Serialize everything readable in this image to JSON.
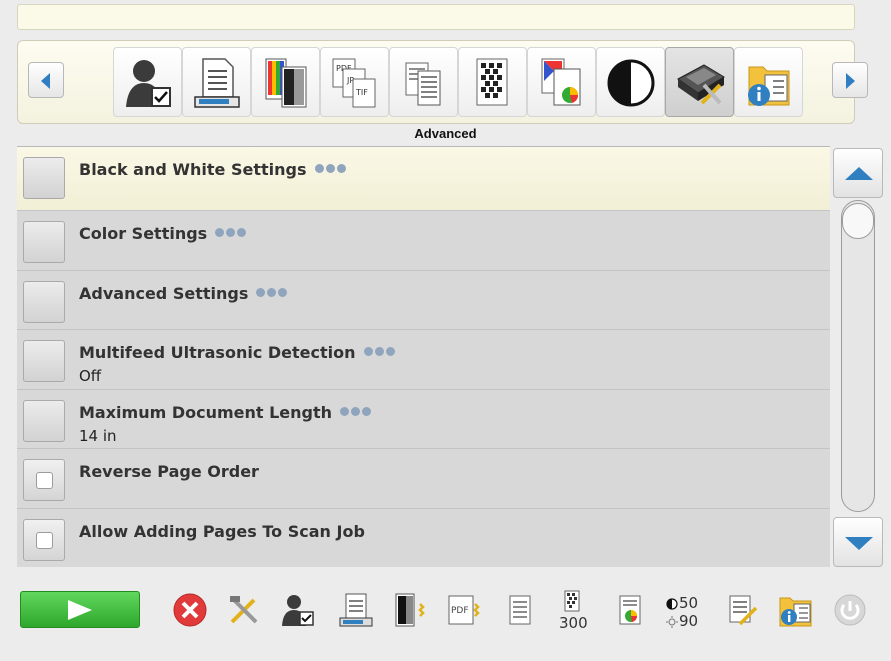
{
  "toolbar": {
    "icons": [
      "user-profile-icon",
      "printed-page-icon",
      "color-pages-icon",
      "file-format-icon",
      "document-pages-icon",
      "resolution-icon",
      "color-document-icon",
      "contrast-icon",
      "scanner-tools-icon",
      "information-icon"
    ],
    "active_index": 8,
    "section_label": "Advanced"
  },
  "settings": {
    "items": [
      {
        "label": "Black and White Settings",
        "value": "",
        "control": "button",
        "has_more": true
      },
      {
        "label": "Color Settings",
        "value": "",
        "control": "button",
        "has_more": true
      },
      {
        "label": "Advanced Settings",
        "value": "",
        "control": "button",
        "has_more": true
      },
      {
        "label": "Multifeed Ultrasonic Detection",
        "value": "Off",
        "control": "button",
        "has_more": true
      },
      {
        "label": "Maximum Document Length",
        "value": "14 in",
        "control": "button",
        "has_more": true
      },
      {
        "label": "Reverse Page Order",
        "value": "",
        "control": "checkbox",
        "checked": false
      },
      {
        "label": "Allow Adding Pages To Scan Job",
        "value": "",
        "control": "checkbox",
        "checked": false
      }
    ]
  },
  "bottombar": {
    "resolution": "300",
    "brightness": "50",
    "contrast": "90"
  },
  "colors": {
    "accent_blue": "#2f7fc1",
    "start_green": "#3bbf39",
    "cancel_red": "#e03a3a"
  }
}
